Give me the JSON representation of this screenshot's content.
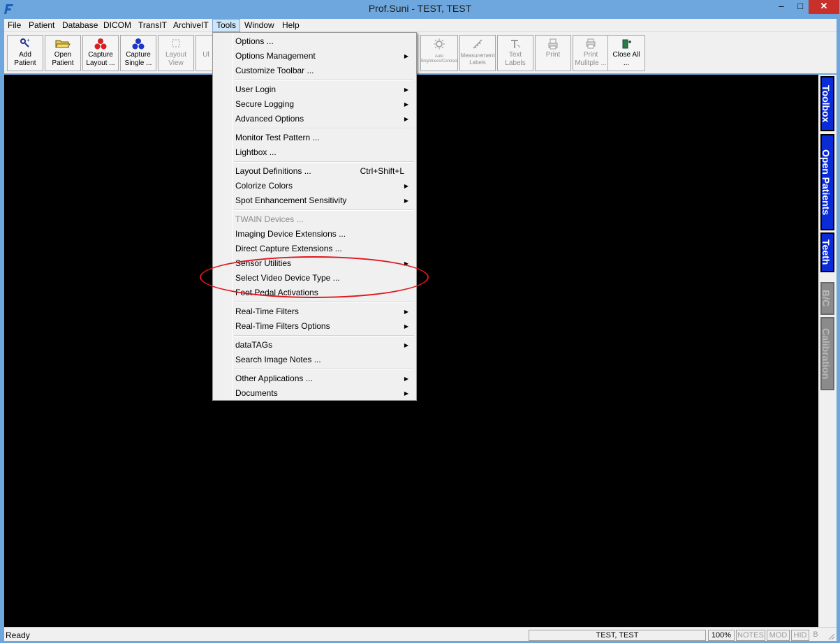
{
  "window": {
    "title": "Prof.Suni - TEST, TEST",
    "minimize_label": "–",
    "maximize_label": "□",
    "close_label": "✕"
  },
  "menubar": {
    "items": [
      "File",
      "Patient",
      "Database",
      "DICOM",
      "TransIT",
      "ArchiveIT",
      "Tools",
      "Window",
      "Help"
    ],
    "active": "Tools"
  },
  "toolbar": {
    "buttons": [
      {
        "label": "Add\nPatient",
        "icon": "add-patient-icon",
        "enabled": true
      },
      {
        "label": "Open\nPatient",
        "icon": "folder-open-icon",
        "enabled": true
      },
      {
        "label": "Capture\nLayout ...",
        "icon": "capture-layout-icon",
        "enabled": true
      },
      {
        "label": "Capture\nSingle ...",
        "icon": "capture-single-icon",
        "enabled": true
      },
      {
        "label": "Layout\nView",
        "icon": "layout-view-icon",
        "enabled": false
      },
      {
        "label": "Ul",
        "icon": "partial-icon",
        "enabled": false
      },
      {
        "label": "Auto\nBrightness/Contrast",
        "icon": "auto-brightness-icon",
        "enabled": false
      },
      {
        "label": "Measurement\nLabels",
        "icon": "measurement-icon",
        "enabled": false
      },
      {
        "label": "Text\nLabels",
        "icon": "text-labels-icon",
        "enabled": false
      },
      {
        "label": "Print",
        "icon": "print-icon",
        "enabled": false
      },
      {
        "label": "Print\nMulitple ...",
        "icon": "print-multiple-icon",
        "enabled": false
      },
      {
        "label": "Close All\n...",
        "icon": "close-all-icon",
        "enabled": true
      }
    ]
  },
  "tools_menu": {
    "items": [
      {
        "label": "Options ...",
        "submenu": false,
        "enabled": true
      },
      {
        "label": "Options Management",
        "submenu": true,
        "enabled": true
      },
      {
        "label": "Customize Toolbar ...",
        "submenu": false,
        "enabled": true
      },
      {
        "label": "User Login",
        "submenu": true,
        "enabled": true
      },
      {
        "label": "Secure Logging",
        "submenu": true,
        "enabled": true
      },
      {
        "label": "Advanced Options",
        "submenu": true,
        "enabled": true
      },
      {
        "label": "Monitor Test Pattern ...",
        "submenu": false,
        "enabled": true
      },
      {
        "label": "Lightbox ...",
        "submenu": false,
        "enabled": true
      },
      {
        "label": "Layout Definitions ...",
        "shortcut": "Ctrl+Shift+L",
        "submenu": false,
        "enabled": true
      },
      {
        "label": "Colorize Colors",
        "submenu": true,
        "enabled": true
      },
      {
        "label": "Spot Enhancement Sensitivity",
        "submenu": true,
        "enabled": true
      },
      {
        "label": "TWAIN Devices ...",
        "submenu": false,
        "enabled": false
      },
      {
        "label": "Imaging Device Extensions ...",
        "submenu": false,
        "enabled": true
      },
      {
        "label": "Direct Capture Extensions ...",
        "submenu": false,
        "enabled": true
      },
      {
        "label": "Sensor Utilities",
        "submenu": true,
        "enabled": true
      },
      {
        "label": "Select Video Device Type ...",
        "submenu": false,
        "enabled": true
      },
      {
        "label": "Foot Pedal Activations",
        "submenu": false,
        "enabled": true
      },
      {
        "label": "Real-Time Filters",
        "submenu": true,
        "enabled": true
      },
      {
        "label": "Real-Time Filters Options",
        "submenu": true,
        "enabled": true
      },
      {
        "label": "dataTAGs",
        "submenu": true,
        "enabled": true
      },
      {
        "label": "Search Image Notes ...",
        "submenu": false,
        "enabled": true
      },
      {
        "label": "Other Applications ...",
        "submenu": true,
        "enabled": true
      },
      {
        "label": "Documents",
        "submenu": true,
        "enabled": true
      }
    ],
    "arrow_glyph": "▶"
  },
  "right_tabs": [
    {
      "label": "Toolbox",
      "enabled": true
    },
    {
      "label": "Open Patients",
      "enabled": true
    },
    {
      "label": "Teeth",
      "enabled": true
    },
    {
      "label": "B/C",
      "enabled": false
    },
    {
      "label": "Calibration",
      "enabled": false
    }
  ],
  "statusbar": {
    "status": "Ready",
    "patient": "TEST, TEST",
    "zoom": "100%",
    "indicators": [
      "NOTES",
      "MOD",
      "HID",
      "B"
    ]
  },
  "colors": {
    "title_bar": "#6ea7dd",
    "canvas": "#000000",
    "tab_blue": "#0a2cd6",
    "annotation": "#e0161c"
  }
}
